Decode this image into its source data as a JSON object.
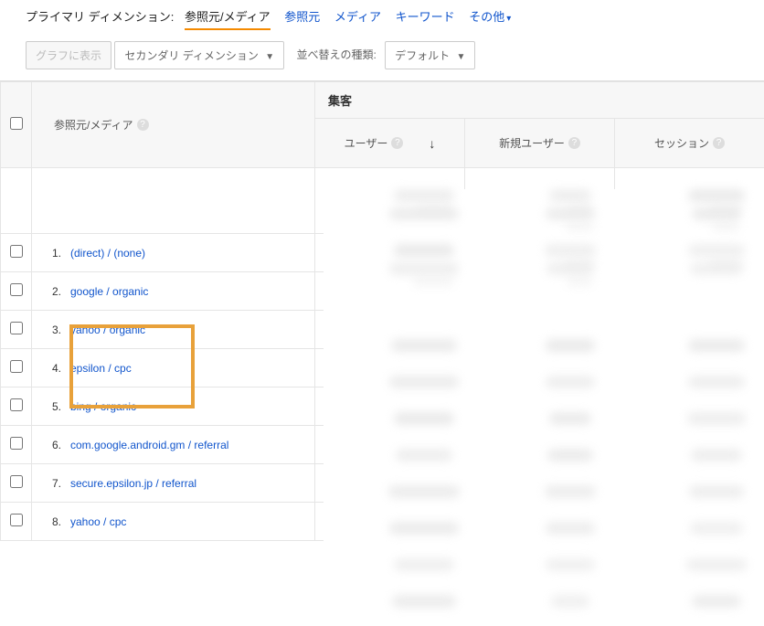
{
  "dimensions": {
    "prefix": "プライマリ ディメンション:",
    "active": "参照元/メディア",
    "tabs": [
      "参照元",
      "メディア",
      "キーワード",
      "その他"
    ]
  },
  "toolbar": {
    "graph_btn": "グラフに表示",
    "secondary": "セカンダリ ディメンション",
    "sort_label": "並べ替えの種類:",
    "sort_value": "デフォルト"
  },
  "headers": {
    "source_media": "参照元/メディア",
    "acquisition": "集客",
    "users": "ユーザー",
    "new_users": "新規ユーザー",
    "sessions": "セッション"
  },
  "rows": [
    {
      "idx": "1.",
      "label": "(direct) / (none)"
    },
    {
      "idx": "2.",
      "label": "google / organic"
    },
    {
      "idx": "3.",
      "label": "yahoo / organic"
    },
    {
      "idx": "4.",
      "label": "epsilon / cpc"
    },
    {
      "idx": "5.",
      "label": "bing / organic"
    },
    {
      "idx": "6.",
      "label": "com.google.android.gm / referral"
    },
    {
      "idx": "7.",
      "label": "secure.epsilon.jp / referral"
    },
    {
      "idx": "8.",
      "label": "yahoo / cpc"
    }
  ]
}
